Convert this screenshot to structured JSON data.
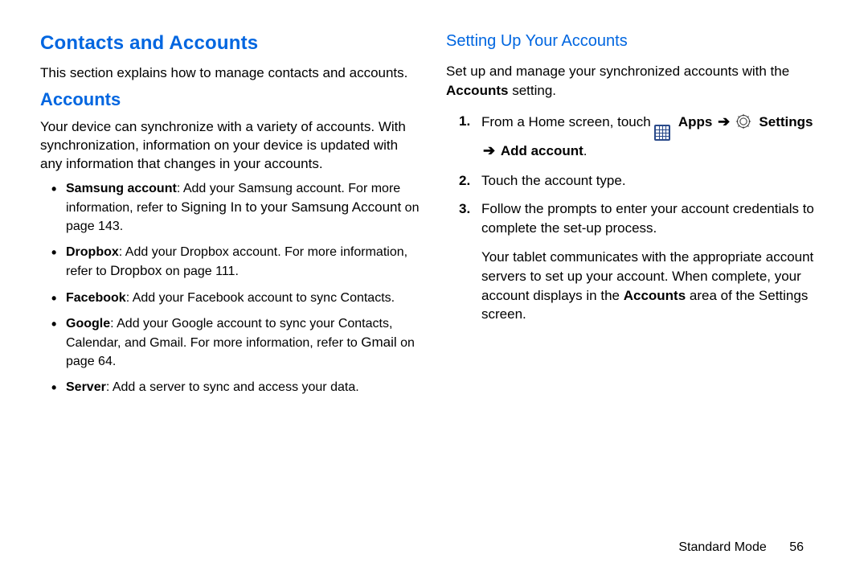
{
  "left": {
    "h1": "Contacts and Accounts",
    "intro": "This section explains how to manage contacts and accounts.",
    "h2": "Accounts",
    "p1": "Your device can synchronize with a variety of accounts. With synchronization, information on your device is updated with any information that changes in your accounts.",
    "bullets": {
      "b1_label": "Samsung account",
      "b1_text1": ": Add your Samsung account. For more information, refer to ",
      "b1_ref": "Signing In to your Samsung Account",
      "b1_text2": " on page 143.",
      "b2_label": "Dropbox",
      "b2_text1": ": Add your Dropbox account. For more information, refer to ",
      "b2_ref": "Dropbox",
      "b2_text2": " on page 111.",
      "b3_label": "Facebook",
      "b3_text": ": Add your Facebook account to sync Contacts.",
      "b4_label": "Google",
      "b4_text1": ": Add your Google account to sync your Contacts, Calendar, and Gmail. For more information, refer to ",
      "b4_ref": "Gmail",
      "b4_text2": " on page 64.",
      "b5_label": "Server",
      "b5_text": ": Add a server to sync and access your data."
    }
  },
  "right": {
    "h3": "Setting Up Your Accounts",
    "intro1": "Set up and manage your synchronized accounts with the ",
    "intro_bold": "Accounts",
    "intro2": " setting.",
    "step1_a": "From a Home screen, touch ",
    "step1_apps": "Apps",
    "step1_settings": "Settings",
    "step1_add": "Add account",
    "step1_dot": ".",
    "step2": "Touch the account type.",
    "step3": "Follow the prompts to enter your account credentials to complete the set-up process.",
    "after1": "Your tablet communicates with the appropriate account servers to set up your account. When complete, your account displays in the ",
    "after_bold": "Accounts",
    "after2": " area of the Settings screen.",
    "num1": "1.",
    "num2": "2.",
    "num3": "3.",
    "arrow": "➔"
  },
  "footer": {
    "mode": "Standard Mode",
    "page": "56"
  }
}
